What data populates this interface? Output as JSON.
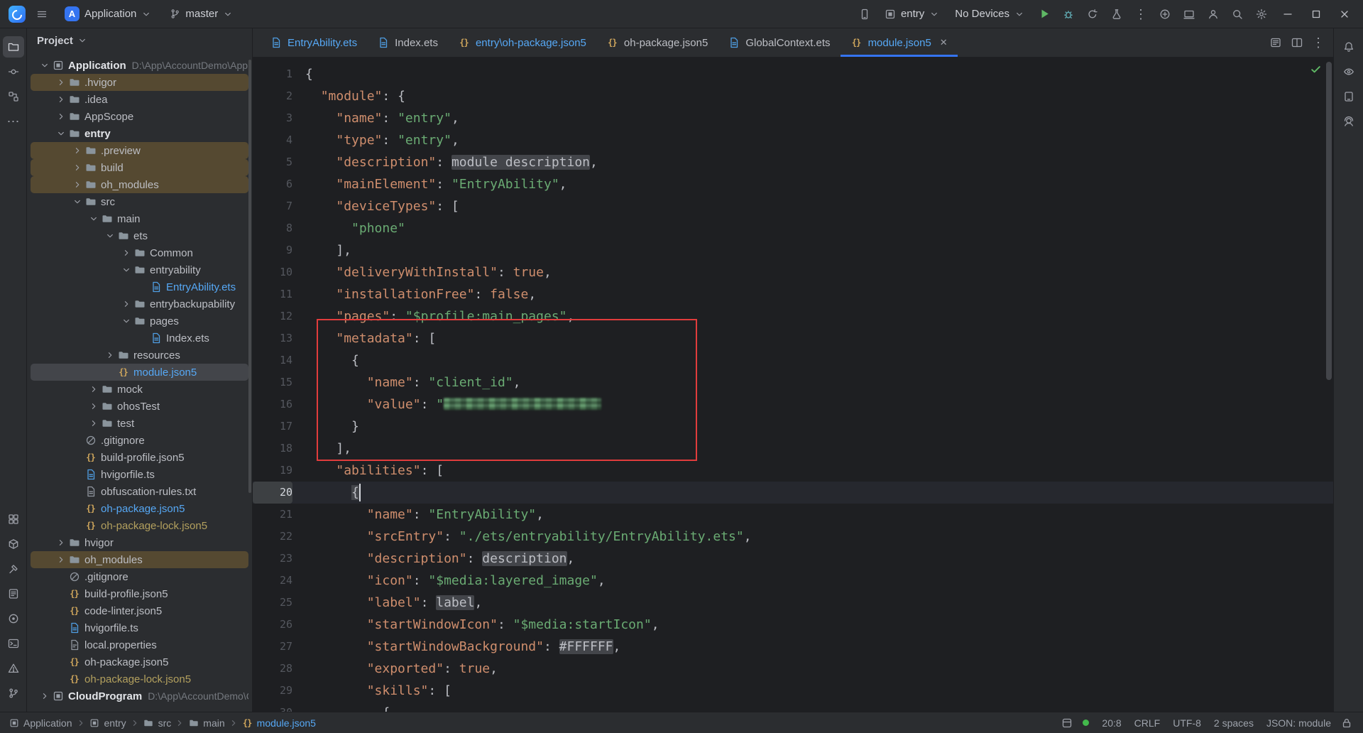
{
  "colors": {
    "accent_blue": "#3574F0",
    "annotation_red": "#E13C3C",
    "modified_file_blue": "#56A8F5",
    "json_key": "#CF8E6D",
    "json_string": "#6AAB73",
    "excluded_row_bg": "#554931",
    "run_green": "#5FB865"
  },
  "titlebar": {
    "app_badge": "A",
    "project_name": "Application",
    "branch": "master",
    "run_target": "entry",
    "device_selector": "No Devices"
  },
  "left_strip": {
    "top": [
      "project",
      "commit",
      "structure",
      "more"
    ],
    "bottom": [
      "services",
      "resources",
      "build",
      "notes",
      "profiler",
      "terminal",
      "problems",
      "vcs"
    ]
  },
  "right_strip": [
    "notifications",
    "previewer",
    "device",
    "assistant"
  ],
  "project_panel": {
    "header": "Project",
    "tree": [
      {
        "label": "Application",
        "suffix": "D:\\App\\AccountDemo\\Application",
        "level": 0,
        "chevron": "open",
        "icon": "module",
        "bold": true
      },
      {
        "label": ".hvigor",
        "level": 1,
        "chevron": "closed",
        "icon": "folder",
        "bg": "warn"
      },
      {
        "label": ".idea",
        "level": 1,
        "chevron": "closed",
        "icon": "folder"
      },
      {
        "label": "AppScope",
        "level": 1,
        "chevron": "closed",
        "icon": "folder"
      },
      {
        "label": "entry",
        "level": 1,
        "chevron": "open",
        "icon": "folder",
        "bold": true
      },
      {
        "label": ".preview",
        "level": 2,
        "chevron": "closed",
        "icon": "folder",
        "bg": "warn"
      },
      {
        "label": "build",
        "level": 2,
        "chevron": "closed",
        "icon": "folder",
        "bg": "warn"
      },
      {
        "label": "oh_modules",
        "level": 2,
        "chevron": "closed",
        "icon": "folder",
        "bg": "warn"
      },
      {
        "label": "src",
        "level": 2,
        "chevron": "open",
        "icon": "folder"
      },
      {
        "label": "main",
        "level": 3,
        "chevron": "open",
        "icon": "folder"
      },
      {
        "label": "ets",
        "level": 4,
        "chevron": "open",
        "icon": "folder"
      },
      {
        "label": "Common",
        "level": 5,
        "chevron": "closed",
        "icon": "folder"
      },
      {
        "label": "entryability",
        "level": 5,
        "chevron": "open",
        "icon": "folder"
      },
      {
        "label": "EntryAbility.ets",
        "level": 6,
        "icon": "ets",
        "color": "blue"
      },
      {
        "label": "entrybackupability",
        "level": 5,
        "chevron": "closed",
        "icon": "folder"
      },
      {
        "label": "pages",
        "level": 5,
        "chevron": "open",
        "icon": "folder"
      },
      {
        "label": "Index.ets",
        "level": 6,
        "icon": "ets"
      },
      {
        "label": "resources",
        "level": 4,
        "chevron": "closed",
        "icon": "folder"
      },
      {
        "label": "module.json5",
        "level": 4,
        "icon": "json",
        "bg": "selected",
        "color": "blue"
      },
      {
        "label": "mock",
        "level": 3,
        "chevron": "closed",
        "icon": "folder"
      },
      {
        "label": "ohosTest",
        "level": 3,
        "chevron": "closed",
        "icon": "folder"
      },
      {
        "label": "test",
        "level": 3,
        "chevron": "closed",
        "icon": "folder"
      },
      {
        "label": ".gitignore",
        "level": 2,
        "icon": "ignore"
      },
      {
        "label": "build-profile.json5",
        "level": 2,
        "icon": "json"
      },
      {
        "label": "hvigorfile.ts",
        "level": 2,
        "icon": "ts"
      },
      {
        "label": "obfuscation-rules.txt",
        "level": 2,
        "icon": "txt"
      },
      {
        "label": "oh-package.json5",
        "level": 2,
        "icon": "json",
        "color": "blue"
      },
      {
        "label": "oh-package-lock.json5",
        "level": 2,
        "icon": "json",
        "color": "olive"
      },
      {
        "label": "hvigor",
        "level": 1,
        "chevron": "closed",
        "icon": "folder"
      },
      {
        "label": "oh_modules",
        "level": 1,
        "chevron": "closed",
        "icon": "folder",
        "bg": "warn"
      },
      {
        "label": ".gitignore",
        "level": 1,
        "icon": "ignore"
      },
      {
        "label": "build-profile.json5",
        "level": 1,
        "icon": "json"
      },
      {
        "label": "code-linter.json5",
        "level": 1,
        "icon": "json"
      },
      {
        "label": "hvigorfile.ts",
        "level": 1,
        "icon": "ts"
      },
      {
        "label": "local.properties",
        "level": 1,
        "icon": "props"
      },
      {
        "label": "oh-package.json5",
        "level": 1,
        "icon": "json"
      },
      {
        "label": "oh-package-lock.json5",
        "level": 1,
        "icon": "json",
        "color": "olive"
      },
      {
        "label": "CloudProgram",
        "suffix": "D:\\App\\AccountDemo\\CloudP",
        "level": 0,
        "chevron": "closed",
        "icon": "module",
        "bold": true
      }
    ]
  },
  "tabs": {
    "items": [
      {
        "label": "EntryAbility.ets",
        "icon": "ets",
        "color": "blue"
      },
      {
        "label": "Index.ets",
        "icon": "ets"
      },
      {
        "label": "entry\\oh-package.json5",
        "icon": "json",
        "color": "blue"
      },
      {
        "label": "oh-package.json5",
        "icon": "json"
      },
      {
        "label": "GlobalContext.ets",
        "icon": "ets"
      },
      {
        "label": "module.json5",
        "icon": "json",
        "color": "blue",
        "active": true
      }
    ],
    "actions": [
      "outline",
      "split",
      "more-v"
    ]
  },
  "editor": {
    "file": "module.json5",
    "current_line": 20,
    "caret_position": "20:8",
    "inspection": "ok",
    "annotation": {
      "shape": "rectangle",
      "color": "#E13C3C",
      "from_line": 13,
      "to_line": 18,
      "note": "metadata block highlighted"
    },
    "lines": [
      [
        [
          "pl",
          "{"
        ]
      ],
      [
        [
          "pl",
          "  "
        ],
        [
          "k",
          "\"module\""
        ],
        [
          "pl",
          ": {"
        ]
      ],
      [
        [
          "pl",
          "    "
        ],
        [
          "k",
          "\"name\""
        ],
        [
          "pl",
          ": "
        ],
        [
          "s",
          "\"entry\""
        ],
        [
          "pl",
          ","
        ]
      ],
      [
        [
          "pl",
          "    "
        ],
        [
          "k",
          "\"type\""
        ],
        [
          "pl",
          ": "
        ],
        [
          "s",
          "\"entry\""
        ],
        [
          "pl",
          ","
        ]
      ],
      [
        [
          "pl",
          "    "
        ],
        [
          "k",
          "\"description\""
        ],
        [
          "pl",
          ": "
        ],
        [
          "f",
          "module description"
        ],
        [
          "pl",
          ","
        ]
      ],
      [
        [
          "pl",
          "    "
        ],
        [
          "k",
          "\"mainElement\""
        ],
        [
          "pl",
          ": "
        ],
        [
          "s",
          "\"EntryAbility\""
        ],
        [
          "pl",
          ","
        ]
      ],
      [
        [
          "pl",
          "    "
        ],
        [
          "k",
          "\"deviceTypes\""
        ],
        [
          "pl",
          ": ["
        ]
      ],
      [
        [
          "pl",
          "      "
        ],
        [
          "s",
          "\"phone\""
        ]
      ],
      [
        [
          "pl",
          "    ],"
        ]
      ],
      [
        [
          "pl",
          "    "
        ],
        [
          "k",
          "\"deliveryWithInstall\""
        ],
        [
          "pl",
          ": "
        ],
        [
          "kw",
          "true"
        ],
        [
          "pl",
          ","
        ]
      ],
      [
        [
          "pl",
          "    "
        ],
        [
          "k",
          "\"installationFree\""
        ],
        [
          "pl",
          ": "
        ],
        [
          "kw",
          "false"
        ],
        [
          "pl",
          ","
        ]
      ],
      [
        [
          "pl",
          "    "
        ],
        [
          "k",
          "\"pages\""
        ],
        [
          "pl",
          ": "
        ],
        [
          "s",
          "\"$profile:main_pages\""
        ],
        [
          "pl",
          ","
        ]
      ],
      [
        [
          "pl",
          "    "
        ],
        [
          "k",
          "\"metadata\""
        ],
        [
          "pl",
          ": ["
        ]
      ],
      [
        [
          "pl",
          "      {"
        ]
      ],
      [
        [
          "pl",
          "        "
        ],
        [
          "k",
          "\"name\""
        ],
        [
          "pl",
          ": "
        ],
        [
          "s",
          "\"client_id\""
        ],
        [
          "pl",
          ","
        ]
      ],
      [
        [
          "pl",
          "        "
        ],
        [
          "k",
          "\"value\""
        ],
        [
          "pl",
          ": "
        ],
        [
          "s",
          "\""
        ],
        [
          "r",
          "redacted"
        ]
      ],
      [
        [
          "pl",
          "      }"
        ]
      ],
      [
        [
          "pl",
          "    ],"
        ]
      ],
      [
        [
          "pl",
          "    "
        ],
        [
          "k",
          "\"abilities\""
        ],
        [
          "pl",
          ": ["
        ]
      ],
      [
        [
          "pl",
          "      "
        ],
        [
          "b",
          "{"
        ]
      ],
      [
        [
          "pl",
          "        "
        ],
        [
          "k",
          "\"name\""
        ],
        [
          "pl",
          ": "
        ],
        [
          "s",
          "\"EntryAbility\""
        ],
        [
          "pl",
          ","
        ]
      ],
      [
        [
          "pl",
          "        "
        ],
        [
          "k",
          "\"srcEntry\""
        ],
        [
          "pl",
          ": "
        ],
        [
          "s",
          "\"./ets/entryability/EntryAbility.ets\""
        ],
        [
          "pl",
          ","
        ]
      ],
      [
        [
          "pl",
          "        "
        ],
        [
          "k",
          "\"description\""
        ],
        [
          "pl",
          ": "
        ],
        [
          "f",
          "description"
        ],
        [
          "pl",
          ","
        ]
      ],
      [
        [
          "pl",
          "        "
        ],
        [
          "k",
          "\"icon\""
        ],
        [
          "pl",
          ": "
        ],
        [
          "s",
          "\"$media:layered_image\""
        ],
        [
          "pl",
          ","
        ]
      ],
      [
        [
          "pl",
          "        "
        ],
        [
          "k",
          "\"label\""
        ],
        [
          "pl",
          ": "
        ],
        [
          "f",
          "label"
        ],
        [
          "pl",
          ","
        ]
      ],
      [
        [
          "pl",
          "        "
        ],
        [
          "k",
          "\"startWindowIcon\""
        ],
        [
          "pl",
          ": "
        ],
        [
          "s",
          "\"$media:startIcon\""
        ],
        [
          "pl",
          ","
        ]
      ],
      [
        [
          "pl",
          "        "
        ],
        [
          "k",
          "\"startWindowBackground\""
        ],
        [
          "pl",
          ": "
        ],
        [
          "f",
          "#FFFFFF"
        ],
        [
          "pl",
          ","
        ]
      ],
      [
        [
          "pl",
          "        "
        ],
        [
          "k",
          "\"exported\""
        ],
        [
          "pl",
          ": "
        ],
        [
          "kw",
          "true"
        ],
        [
          "pl",
          ","
        ]
      ],
      [
        [
          "pl",
          "        "
        ],
        [
          "k",
          "\"skills\""
        ],
        [
          "pl",
          ": ["
        ]
      ],
      [
        [
          "pl",
          "          {"
        ]
      ]
    ]
  },
  "statusbar": {
    "breadcrumbs": [
      {
        "label": "Application",
        "icon": "module"
      },
      {
        "label": "entry",
        "icon": "module"
      },
      {
        "label": "src",
        "icon": "folder"
      },
      {
        "label": "main",
        "icon": "folder"
      },
      {
        "label": "module.json5",
        "icon": "json",
        "color": "blue"
      }
    ],
    "items": [
      "20:8",
      "CRLF",
      "UTF-8",
      "2 spaces",
      "JSON: module"
    ]
  }
}
